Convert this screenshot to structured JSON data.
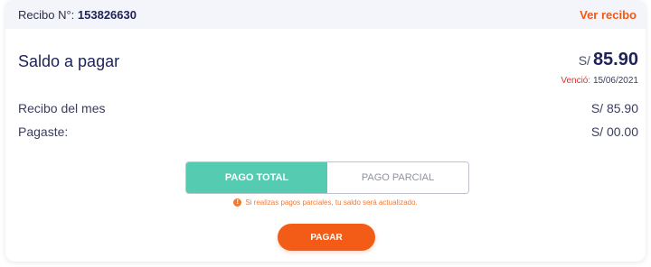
{
  "header": {
    "receipt_label": "Recibo N°:",
    "receipt_number": "153826630",
    "view_receipt_link": "Ver recibo"
  },
  "balance": {
    "title": "Saldo a pagar",
    "currency": "S/",
    "amount": "85.90",
    "due_label": "Venció:",
    "due_date": "15/06/2021"
  },
  "details": {
    "month_receipt_label": "Recibo del mes",
    "month_receipt_value": "S/ 85.90",
    "paid_label": "Pagaste:",
    "paid_value": "S/ 00.00"
  },
  "payment_options": {
    "total_label": "PAGO TOTAL",
    "partial_label": "PAGO PARCIAL",
    "selected": "PAGO TOTAL"
  },
  "note": {
    "icon": "exclamation-icon",
    "text": "Si realizas pagos parciales, tu saldo será actualizado."
  },
  "actions": {
    "pay_label": "PAGAR"
  },
  "colors": {
    "primary_navy": "#1d2358",
    "accent_orange": "#f35c16",
    "teal_active": "#55cbb1",
    "due_red": "#e0302e"
  }
}
